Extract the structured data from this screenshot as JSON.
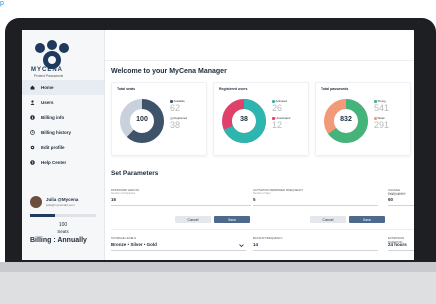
{
  "sidebar": {
    "logo_text": "MYCENA",
    "logo_sub": "Protect Passwords",
    "items": [
      {
        "label": "Home",
        "icon": "home-icon"
      },
      {
        "label": "Users",
        "icon": "user-icon"
      },
      {
        "label": "Billing info",
        "icon": "info-icon"
      },
      {
        "label": "Billing history",
        "icon": "history-icon"
      },
      {
        "label": "Edit profile",
        "icon": "gear-icon"
      },
      {
        "label": "Help Center",
        "icon": "help-icon"
      }
    ],
    "profile": {
      "name": "Julia @Mycena",
      "email": "julia@mycenaltd.com",
      "seat_usage": 0.38
    },
    "seats_count": "100",
    "seats_label": "Seats",
    "billing_label": "Billing : Annually"
  },
  "main": {
    "welcome": "Welcome to your MyCena Manager",
    "cards": [
      {
        "title": "Total seats",
        "center": "100",
        "legend": [
          {
            "label": "Available",
            "value": "62",
            "color": "#3e526a"
          },
          {
            "label": "Registered",
            "value": "38",
            "color": "#c9d2dc"
          }
        ]
      },
      {
        "title": "Registered users",
        "center": "38",
        "legend": [
          {
            "label": "Activated",
            "value": "26",
            "color": "#2db5b0"
          },
          {
            "label": "Unactivated",
            "value": "12",
            "color": "#e0416b"
          }
        ]
      },
      {
        "title": "Total passwords",
        "center": "832",
        "legend": [
          {
            "label": "Strong",
            "value": "541",
            "color": "#45b47a"
          },
          {
            "label": "Weak",
            "value": "291",
            "color": "#f29a78"
          }
        ]
      }
    ],
    "set_params": "Set Parameters",
    "fields": [
      {
        "label": "Password length",
        "sub": "Number of characters",
        "value": "16"
      },
      {
        "label": "Activation reminder frequency",
        "sub": "Number of days",
        "value": "5"
      },
      {
        "label": "Change frequency",
        "sub": "Number of days",
        "value": "60"
      },
      {
        "label": "Storage levels",
        "sub": "",
        "value": "Bronze • Silver • Gold"
      },
      {
        "label": "Backup frequency",
        "sub": "",
        "value": "14"
      },
      {
        "label": "Extension duration",
        "sub": "",
        "value": "24 hours"
      }
    ],
    "cancel_label": "Cancel",
    "save_label": "Save"
  },
  "colors": {
    "brand": "#1f3a5c",
    "accent_save": "#4d6a8c"
  }
}
